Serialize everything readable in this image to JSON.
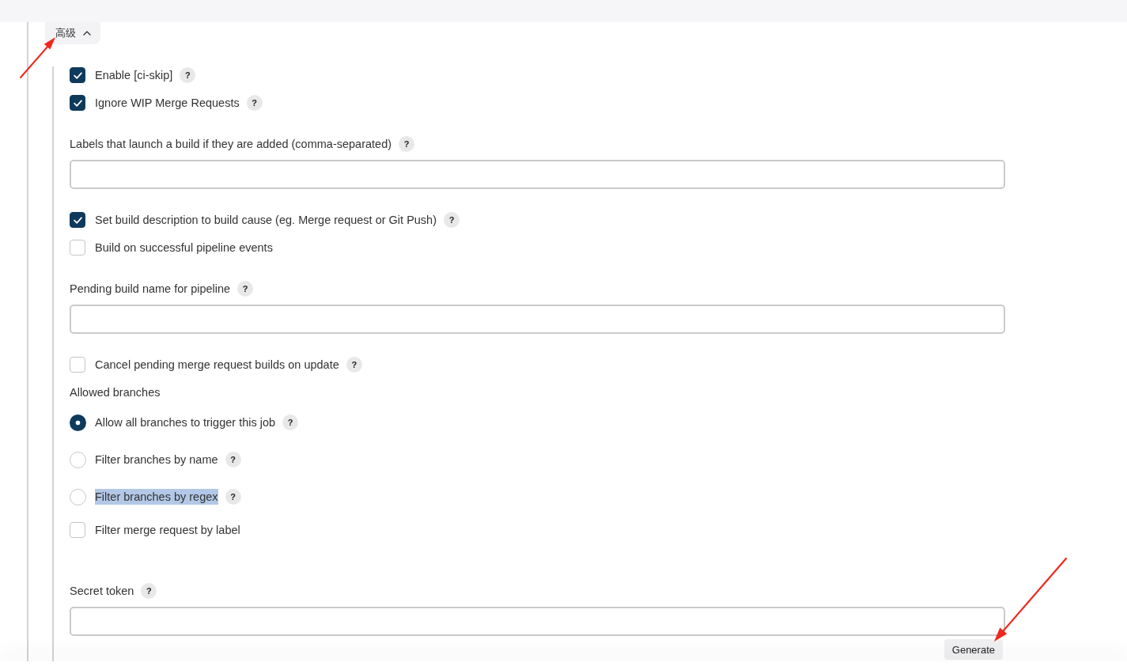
{
  "header": {
    "advanced_toggle": {
      "label": "高级",
      "expanded": true
    }
  },
  "fields": [
    {
      "kind": "checkbox",
      "label": "Enable [ci-skip]",
      "checked": true,
      "help": "?"
    },
    {
      "kind": "checkbox",
      "label": "Ignore WIP Merge Requests",
      "checked": true,
      "help": "?"
    },
    {
      "kind": "text",
      "label": "Labels that launch a build if they are added (comma-separated)",
      "help": "?"
    },
    {
      "kind": "checkbox",
      "label": "Set build description to build cause (eg. Merge request or Git Push)",
      "checked": true,
      "help": "?"
    },
    {
      "kind": "checkbox",
      "label": "Build on successful pipeline events",
      "checked": false
    },
    {
      "kind": "text",
      "label": "Pending build name for pipeline",
      "help": "?"
    },
    {
      "kind": "checkbox",
      "label": "Cancel pending merge request builds on update",
      "checked": false,
      "help": "?"
    },
    {
      "kind": "radio-group",
      "label": "Allowed branches",
      "options": [
        {
          "label": "Allow all branches to trigger this job",
          "selected": true,
          "highlighted": false,
          "help": "?"
        },
        {
          "label": "Filter branches by name",
          "selected": false,
          "highlighted": false,
          "help": "?"
        },
        {
          "label": "Filter branches by regex",
          "selected": false,
          "highlighted": true,
          "help": "?"
        }
      ]
    },
    {
      "kind": "checkbox",
      "label": "Filter merge request by label",
      "checked": false
    },
    {
      "kind": "text",
      "label": "Secret token",
      "help": "?",
      "button": "Generate"
    }
  ]
}
